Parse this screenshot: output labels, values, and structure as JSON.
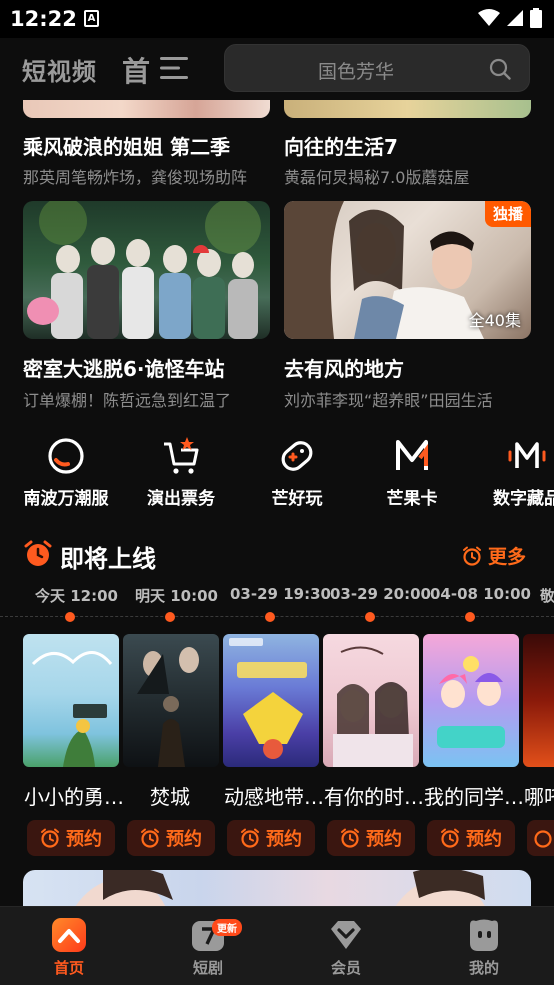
{
  "status_bar": {
    "time": "12:22",
    "notification_letter": "A"
  },
  "header": {
    "tab_short_video": "短视频",
    "tab_home_partial": "首页",
    "search_placeholder": "国色芳华"
  },
  "top_cards": [
    {
      "title": "乘风破浪的姐姐 第二季",
      "subtitle": "那英周笔畅炸场，龚俊现场助阵"
    },
    {
      "title": "向往的生活7",
      "subtitle": "黄磊何炅揭秘7.0版蘑菇屋"
    }
  ],
  "cards": [
    {
      "title": "密室大逃脱6·诡怪车站",
      "subtitle": "订单爆棚！陈哲远急到红温了"
    },
    {
      "title": "去有风的地方",
      "subtitle": "刘亦菲李现“超养眼”田园生活",
      "badge": "独播",
      "episodes": "全40集"
    }
  ],
  "quick_entries": [
    {
      "label": "南波万潮服",
      "icon": "smile-ring-icon"
    },
    {
      "label": "演出票务",
      "icon": "cart-star-icon"
    },
    {
      "label": "芒好玩",
      "icon": "gamepad-icon"
    },
    {
      "label": "芒果卡",
      "icon": "m-logo-icon"
    },
    {
      "label": "数字藏品",
      "icon": "m-digital-icon"
    }
  ],
  "upcoming": {
    "title": "即将上线",
    "more_label": "更多",
    "items": [
      {
        "time": "今天 12:00",
        "title": "小小的勇…",
        "remind_label": "预约"
      },
      {
        "time": "明天 10:00",
        "title": "焚城",
        "remind_label": "预约"
      },
      {
        "time": "03-29 19:30",
        "title": "动感地带…",
        "remind_label": "预约"
      },
      {
        "time": "03-29 20:00",
        "title": "有你的时…",
        "remind_label": "预约"
      },
      {
        "time": "04-08 10:00",
        "title": "我的同学…",
        "remind_label": "预约"
      },
      {
        "time": "敬",
        "title": "哪吒",
        "remind_label": ""
      }
    ]
  },
  "bottom_nav": [
    {
      "label": "首页",
      "active": true
    },
    {
      "label": "短剧",
      "badge": "更新"
    },
    {
      "label": "会员"
    },
    {
      "label": "我的"
    }
  ],
  "colors": {
    "accent": "#ff5a1f",
    "background": "#0d0d0d",
    "muted": "#8d8d8d"
  }
}
